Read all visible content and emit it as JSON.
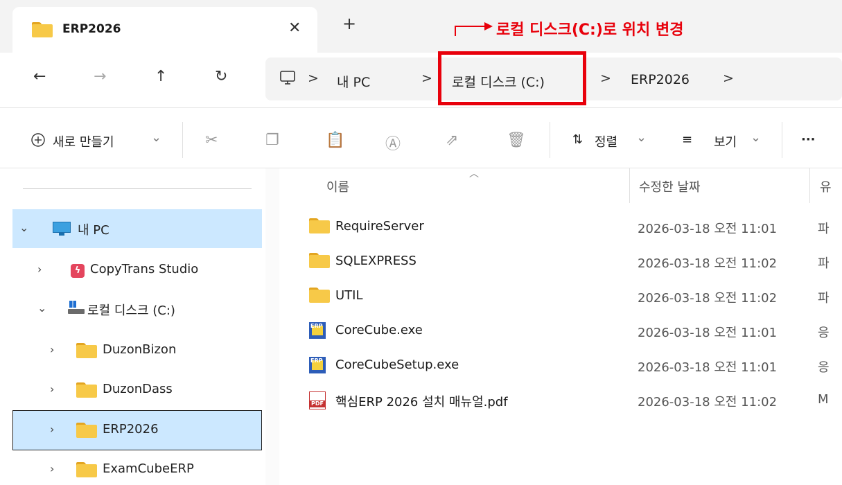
{
  "tab": {
    "title": "ERP2026",
    "close_glyph": "✕",
    "new_tab_glyph": "+"
  },
  "annotation": {
    "text": "로컬 디스크(C:)로 위치 변경",
    "color": "#e8000b"
  },
  "nav": {
    "back": "←",
    "forward": "→",
    "up": "↑",
    "refresh": "↻"
  },
  "breadcrumb": {
    "separator": ">",
    "items": [
      "내 PC",
      "로컬 디스크 (C:)",
      "ERP2026"
    ]
  },
  "toolbar": {
    "new_label": "새로 만들기",
    "sort_label": "정렬",
    "view_label": "보기",
    "more_label": "···",
    "dropdown_glyph": "⌄"
  },
  "columns": {
    "name": "이름",
    "date": "수정한 날짜",
    "type": "유"
  },
  "files": [
    {
      "name": "RequireServer",
      "date": "2026-03-18 오전 11:01",
      "type": "파",
      "icon": "folder-icon"
    },
    {
      "name": "SQLEXPRESS",
      "date": "2026-03-18 오전 11:02",
      "type": "파",
      "icon": "folder-icon"
    },
    {
      "name": "UTIL",
      "date": "2026-03-18 오전 11:02",
      "type": "파",
      "icon": "folder-icon"
    },
    {
      "name": "CoreCube.exe",
      "date": "2026-03-18 오전 11:01",
      "type": "응",
      "icon": "exe-icon"
    },
    {
      "name": "CoreCubeSetup.exe",
      "date": "2026-03-18 오전 11:01",
      "type": "응",
      "icon": "exe-icon"
    },
    {
      "name": "핵심ERP 2026 설치 매뉴얼.pdf",
      "date": "2026-03-18 오전 11:02",
      "type": "M",
      "icon": "pdf-icon"
    }
  ],
  "sidebar": {
    "items": [
      {
        "label": "내 PC",
        "expanded": true,
        "selected": true,
        "icon": "monitor-icon"
      },
      {
        "label": "CopyTrans Studio",
        "expanded": false,
        "icon": "copytrans-icon"
      },
      {
        "label": "로컬 디스크 (C:)",
        "expanded": true,
        "icon": "drive-icon"
      },
      {
        "label": "DuzonBizon",
        "expanded": false,
        "icon": "folder-icon"
      },
      {
        "label": "DuzonDass",
        "expanded": false,
        "icon": "folder-icon"
      },
      {
        "label": "ERP2026",
        "expanded": false,
        "focused": true,
        "icon": "folder-icon"
      },
      {
        "label": "ExamCubeERP",
        "expanded": false,
        "icon": "folder-icon"
      }
    ]
  },
  "colors": {
    "accent_red": "#e8000b",
    "selection": "#cce8ff",
    "folder": "#f7c948"
  }
}
